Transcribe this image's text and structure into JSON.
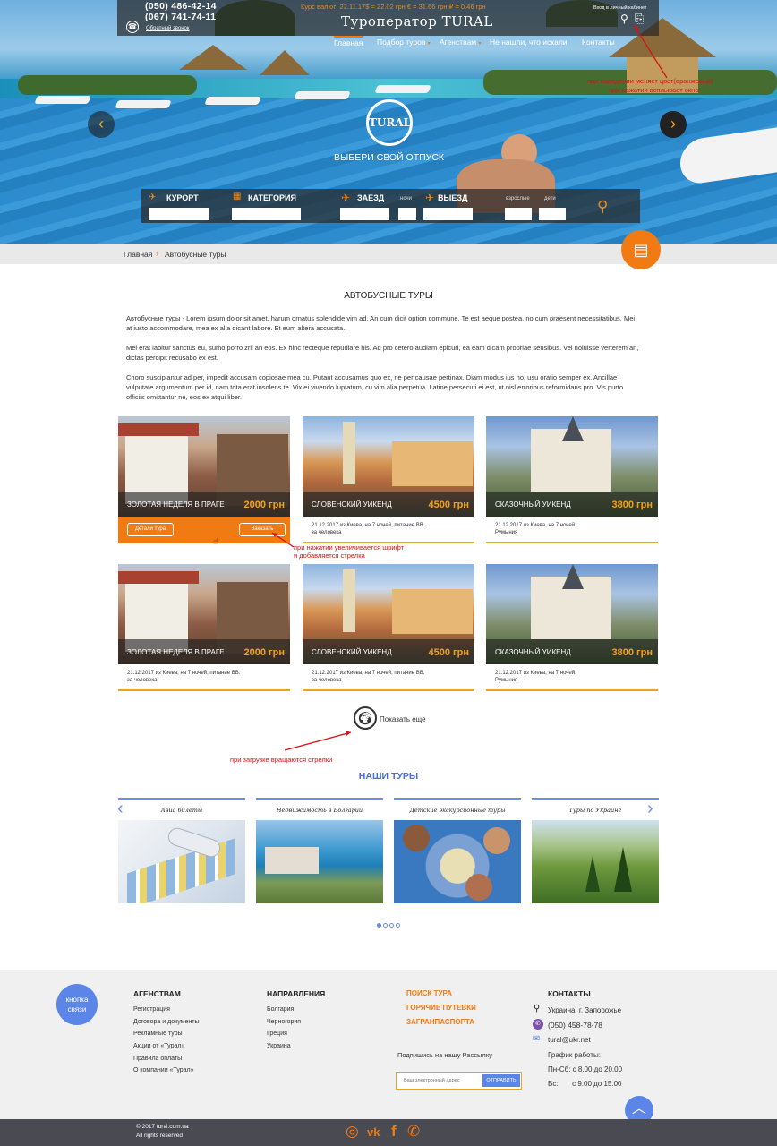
{
  "header": {
    "phone1": "(050) 486-42-14",
    "phone2": "(067) 741-74-11",
    "callback": "Обратный звонок",
    "rates": "Курс валют: 22.11.17$ = 22.02 грн € = 31.66 грн  ₽ = 0.46 грн",
    "brand": "Туроператор TURAL",
    "login": "Вход в личный кабинет"
  },
  "nav": [
    "Главная",
    "Подбор туров",
    "Агенствам",
    "Не нашли, что искали",
    "Контакты"
  ],
  "annotations": {
    "hover": "при наведении меняет цвет(оранжевый)",
    "popup": "при нажатии всплывает окно",
    "card1": "при нажатии увеличивается шрифт",
    "card2": "и добавляется стрелка",
    "spin": "при загрузке вращаются стрелки"
  },
  "hero": {
    "logo": "TURAL",
    "slogan": "ВЫБЕРИ СВОЙ ОТПУСК",
    "prev": "‹",
    "next": "›"
  },
  "search": {
    "resort": "КУРОРТ",
    "category": "КАТЕГОРИЯ",
    "depart": "ЗАЕЗД",
    "nights": "ночи",
    "return": "ВЫЕЗД",
    "adults": "взрослые",
    "children": "дети"
  },
  "breadcrumb": {
    "home": "Главная",
    "current": "Автобусные туры"
  },
  "page": {
    "title": "АВТОБУСНЫЕ ТУРЫ",
    "p1": "Автобусные туры - Lorem ipsum dolor sit amet, harum ornatus splendide vim ad. An cum dicit option commune. Te est aeque postea, no cum praesent necessitatibus. Mei at iusto accommodare, mea ex alia dicant labore. Et eum altera accusata.",
    "p2": "Mei erat labitur sanctus eu, sumo porro zril an eos. Ex hinc recteque repudiare his. Ad pro cetero audiam epicuri, ea eam dicam propriae sensibus. Vel noluisse verterem an, dictas percipit recusabo ex est.",
    "p3": "Choro suscipiantur ad per, impedit accusam copiosae mea cu. Putant accusamus quo ex, ne per causae pertinax. Diam modus ius no, usu oratio semper ex. Ancillae vulputate argumentum per id, nam tota erat insolens te. Vix ei vivendo luptatum, cu vim alia perpetua. Latine persecuti ei est, ut nisl erroribus reformidans pro. Vis purto officiis omittantur ne, eos ex atqui liber."
  },
  "cards": [
    {
      "title": "ЗОЛОТАЯ НЕДЕЛЯ В ПРАГЕ",
      "price": "2000 грн",
      "desc1": "",
      "desc2": "",
      "details": "Детали тура",
      "order": "Заказать"
    },
    {
      "title": "СЛОВЕНСКИЙ УИКЕНД",
      "price": "4500 грн",
      "desc1": "21.12.2017 из Киева, на 7 ночей, питание BB.",
      "desc2": "за человека"
    },
    {
      "title": "СКАЗОЧНЫЙ УИКЕНД",
      "price": "3800 грн",
      "desc1": "21.12.2017 из Киева, на 7 ночей.",
      "desc2": "Румыния"
    },
    {
      "title": "ЗОЛОТАЯ НЕДЕЛЯ В ПРАГЕ",
      "price": "2000 грн",
      "desc1": "21.12.2017 из Киева, на 7 ночей, питание BB.",
      "desc2": "за человека"
    },
    {
      "title": "СЛОВЕНСКИЙ УИКЕНД",
      "price": "4500 грн",
      "desc1": "21.12.2017 из Киева, на 7 ночей, питание BB.",
      "desc2": "за человека"
    },
    {
      "title": "СКАЗОЧНЫЙ УИКЕНД",
      "price": "3800 грн",
      "desc1": "21.12.2017 из Киева, на 7 ночей.",
      "desc2": "Румыния"
    }
  ],
  "show_more": "Показать еще",
  "our_tours": {
    "title": "НАШИ ТУРЫ",
    "items": [
      "Авиа билеты",
      "Недвижимость в Болгарии",
      "Детские экскурсионные туры",
      "Туры по Украине"
    ]
  },
  "footer": {
    "callback_btn": "кнопка связи",
    "col1_title": "АГЕНСТВАМ",
    "col1": [
      "Регистрация",
      "Договора и документы",
      "Рекламные туры",
      "Акции от «Турал»",
      "Правила оплаты",
      "О компании «Турал»"
    ],
    "col2_title": "НАПРАВЛЕНИЯ",
    "col2": [
      "Болгария",
      "Черногория",
      "Греция",
      "Украина"
    ],
    "col3": [
      "ПОИСК ТУРА",
      "ГОРЯЧИЕ ПУТЕВКИ",
      "ЗАГРАНПАСПОРТА"
    ],
    "subscribe": "Подпишись на нашу Рассылку",
    "email_placeholder": "Ваш электронный адрес",
    "send": "ОТПРАВИТЬ",
    "col4_title": "КОНТАКТЫ",
    "address": "Украина, г. Запорожье",
    "phone": "(050) 458-78-78",
    "email": "tural@ukr.net",
    "hours_title": "График работы:",
    "hours1": "Пн-Сб: с 8.00 до 20.00",
    "hours2": "Вс:       с 9.00 до 15.00",
    "copyright1": "© 2017 tural.com.ua",
    "copyright2": "All rights reserved"
  }
}
